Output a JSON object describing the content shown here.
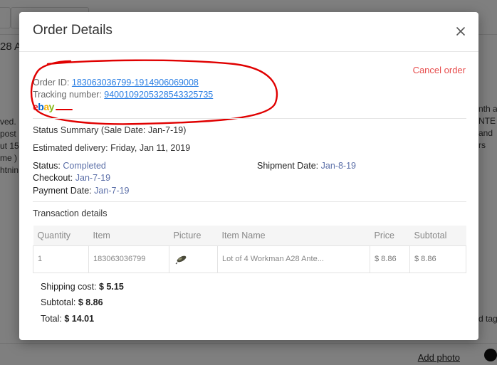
{
  "background": {
    "sku_fragment": "28 A",
    "text_left": [
      "ved. I",
      "post",
      "ut 15",
      "me )",
      "htnin"
    ],
    "text_right": [
      "nth a",
      "NTE",
      "and",
      "rs"
    ],
    "tag_fragment": "d tag",
    "add_photo_label": "Add photo"
  },
  "modal": {
    "title": "Order Details",
    "cancel_label": "Cancel order",
    "order_id_label": "Order ID:",
    "order_id": "183063036799-1914906069008",
    "tracking_label": "Tracking number:",
    "tracking_number": "9400109205328543325735",
    "status_summary": "Status Summary (Sale Date: Jan-7-19)",
    "estimated_delivery": "Estimated delivery: Friday, Jan 11, 2019",
    "status_label": "Status:",
    "status_value": "Completed",
    "checkout_label": "Checkout:",
    "checkout_value": "Jan-7-19",
    "payment_label": "Payment Date:",
    "payment_value": "Jan-7-19",
    "shipment_label": "Shipment Date:",
    "shipment_value": "Jan-8-19",
    "transaction_heading": "Transaction details",
    "table": {
      "headers": [
        "Quantity",
        "Item",
        "Picture",
        "Item Name",
        "Price",
        "Subtotal"
      ],
      "rows": [
        {
          "quantity": "1",
          "item": "183063036799",
          "item_name": "Lot of 4 Workman A28 Ante...",
          "price": "$ 8.86",
          "subtotal": "$ 8.86"
        }
      ]
    },
    "shipping_cost_label": "Shipping cost:",
    "shipping_cost": "$ 5.15",
    "subtotal_label": "Subtotal:",
    "subtotal": "$ 8.86",
    "total_label": "Total:",
    "total": "$ 14.01"
  },
  "colors": {
    "accent_link": "#2a7ee3",
    "cancel": "#e74c4c",
    "annotation": "#e00000"
  }
}
